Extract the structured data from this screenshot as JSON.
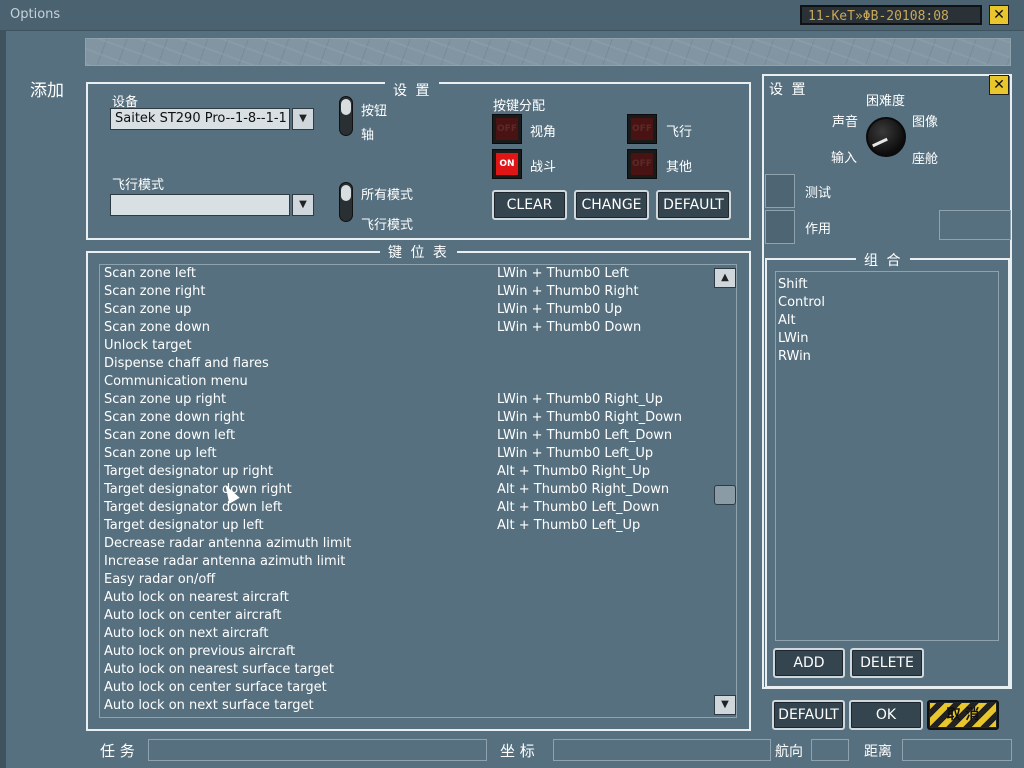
{
  "window": {
    "title": "Options",
    "clock": "11-KeТ»ΦB-20108:08"
  },
  "side_label": "添加",
  "settings_panel": {
    "legend": "设  置",
    "device_label": "设备",
    "device_value": "Saitek ST290 Pro--1-8--1-1",
    "toggle1": {
      "top": "按钮",
      "bottom": "轴"
    },
    "flight_mode_label": "飞行模式",
    "flight_mode_value": "",
    "toggle2": {
      "top": "所有模式",
      "bottom": "飞行模式"
    },
    "assign_label": "按键分配",
    "assign": [
      {
        "label": "视角",
        "state": "OFF",
        "on": false
      },
      {
        "label": "飞行",
        "state": "OFF",
        "on": false
      },
      {
        "label": "战斗",
        "state": "ON",
        "on": true
      },
      {
        "label": "其他",
        "state": "OFF",
        "on": false
      }
    ],
    "buttons": {
      "clear": "CLEAR",
      "change": "CHANGE",
      "default": "DEFAULT"
    }
  },
  "keymap": {
    "legend": "键 位 表",
    "rows": [
      {
        "action": "Scan zone left",
        "key": "LWin + Thumb0 Left"
      },
      {
        "action": "Scan zone right",
        "key": "LWin + Thumb0 Right"
      },
      {
        "action": "Scan zone up",
        "key": "LWin + Thumb0 Up"
      },
      {
        "action": "Scan zone down",
        "key": "LWin + Thumb0 Down"
      },
      {
        "action": "Unlock target",
        "key": ""
      },
      {
        "action": "Dispense chaff and flares",
        "key": ""
      },
      {
        "action": "Communication menu",
        "key": ""
      },
      {
        "action": "Scan zone up right",
        "key": "LWin + Thumb0 Right_Up"
      },
      {
        "action": "Scan zone down right",
        "key": "LWin + Thumb0 Right_Down"
      },
      {
        "action": "Scan zone down left",
        "key": "LWin + Thumb0 Left_Down"
      },
      {
        "action": "Scan zone up left",
        "key": "LWin + Thumb0 Left_Up"
      },
      {
        "action": "Target designator up right",
        "key": "Alt + Thumb0 Right_Up"
      },
      {
        "action": "Target designator down right",
        "key": "Alt + Thumb0 Right_Down"
      },
      {
        "action": "Target designator down left",
        "key": "Alt + Thumb0 Left_Down"
      },
      {
        "action": "Target designator up left",
        "key": "Alt + Thumb0 Left_Up"
      },
      {
        "action": "Decrease radar antenna azimuth limit",
        "key": ""
      },
      {
        "action": "Increase radar antenna azimuth limit",
        "key": ""
      },
      {
        "action": "Easy radar on/off",
        "key": ""
      },
      {
        "action": "Auto lock on nearest aircraft",
        "key": ""
      },
      {
        "action": "Auto lock on center aircraft",
        "key": ""
      },
      {
        "action": "Auto lock on next aircraft",
        "key": ""
      },
      {
        "action": "Auto lock on previous aircraft",
        "key": ""
      },
      {
        "action": "Auto lock on nearest surface target",
        "key": ""
      },
      {
        "action": "Auto lock on center surface target",
        "key": ""
      },
      {
        "action": "Auto lock on next surface target",
        "key": ""
      }
    ]
  },
  "right_panel": {
    "title": "设 置",
    "difficulty_label": "困难度",
    "knob_labels": {
      "sound": "声音",
      "image": "图像",
      "input": "输入",
      "cockpit": "座舱"
    },
    "test_label": "测试",
    "action_label": "作用",
    "combo_legend": "组 合",
    "combo_items": [
      "Shift",
      "Control",
      "Alt",
      "LWin",
      "RWin"
    ],
    "add": "ADD",
    "delete": "DELETE"
  },
  "footer": {
    "default": "DEFAULT",
    "ok": "OK",
    "cancel": "取 消",
    "task_label": "任 务",
    "coord_label": "坐 标",
    "heading_label": "航向",
    "distance_label": "距离"
  },
  "colors": {
    "background": "#56707f",
    "led_on": "#e01616",
    "accent": "#e8c62c"
  },
  "icons": [
    "close-icon",
    "dropdown-arrow-icon",
    "scroll-up-icon",
    "scroll-down-icon",
    "mouse-cursor-icon"
  ]
}
